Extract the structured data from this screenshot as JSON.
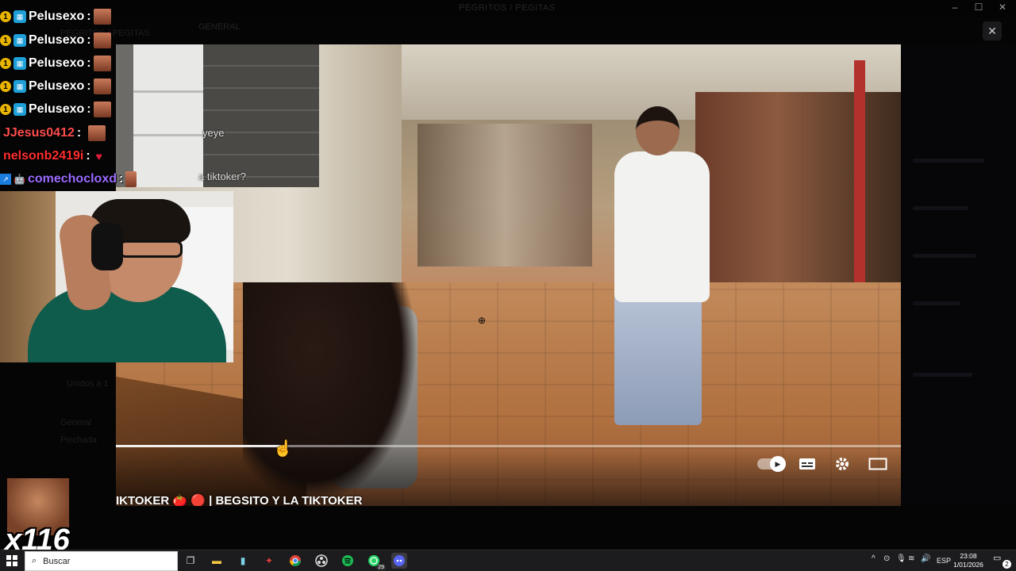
{
  "window": {
    "title": "PEGRITOS / PEGITAS",
    "channel_header": "GENERAL",
    "sidebar_faint_items": [
      "PEGRITOS / PEGITAS",
      "Unidos a 1",
      "General",
      "Pinchada"
    ],
    "controls": {
      "minimize": "–",
      "maximize": "☐",
      "close": "✕"
    }
  },
  "viewer": {
    "close_label": "✕"
  },
  "chat": {
    "messages": [
      {
        "user": "Pelusexo",
        "color": "#ffffff",
        "badges": [
          "sub",
          "gift"
        ],
        "emote": "face-emote"
      },
      {
        "user": "Pelusexo",
        "color": "#ffffff",
        "badges": [
          "sub",
          "gift"
        ],
        "emote": "face-emote"
      },
      {
        "user": "Pelusexo",
        "color": "#ffffff",
        "badges": [
          "sub",
          "gift"
        ],
        "emote": "face-emote"
      },
      {
        "user": "Pelusexo",
        "color": "#ffffff",
        "badges": [
          "sub",
          "gift"
        ],
        "emote": "face-emote"
      },
      {
        "user": "Pelusexo",
        "color": "#ffffff",
        "badges": [
          "sub",
          "gift"
        ],
        "emote": "face-emote"
      },
      {
        "user": "JJesus0412",
        "color": "#ff4d4d",
        "badges": [],
        "emote": "face-emote"
      },
      {
        "user": "nelsonb2419i",
        "color": "#ff2d2d",
        "badges": [],
        "emote": "heart-emote"
      },
      {
        "user": "comechocloxd",
        "color": "#9b6bff",
        "badges": [
          "prime",
          "bot"
        ],
        "emote": "face-emote"
      }
    ],
    "separator": ":"
  },
  "overlay_chat": {
    "line1": "yeye",
    "line2": "a tiktoker?"
  },
  "video": {
    "caption": "IKTOKER 🍅 🔴 | BEGSITO Y LA TIKTOKER",
    "progress_fraction": 0.21,
    "controls": {
      "autoplay": "autoplay-toggle",
      "subtitles": "subtitles-icon",
      "settings": "gear-icon",
      "theater": "theater-mode-icon"
    }
  },
  "combo": {
    "count": "x116"
  },
  "taskbar": {
    "search_placeholder": "Buscar",
    "apps": [
      "task-view",
      "file-explorer",
      "notepad",
      "app-red",
      "chrome",
      "obs",
      "spotify",
      "whatsapp",
      "discord"
    ],
    "whatsapp_badge": "29",
    "language": "ESP",
    "time": "23:08",
    "date": "1/01/2026",
    "notification_count": "2"
  }
}
